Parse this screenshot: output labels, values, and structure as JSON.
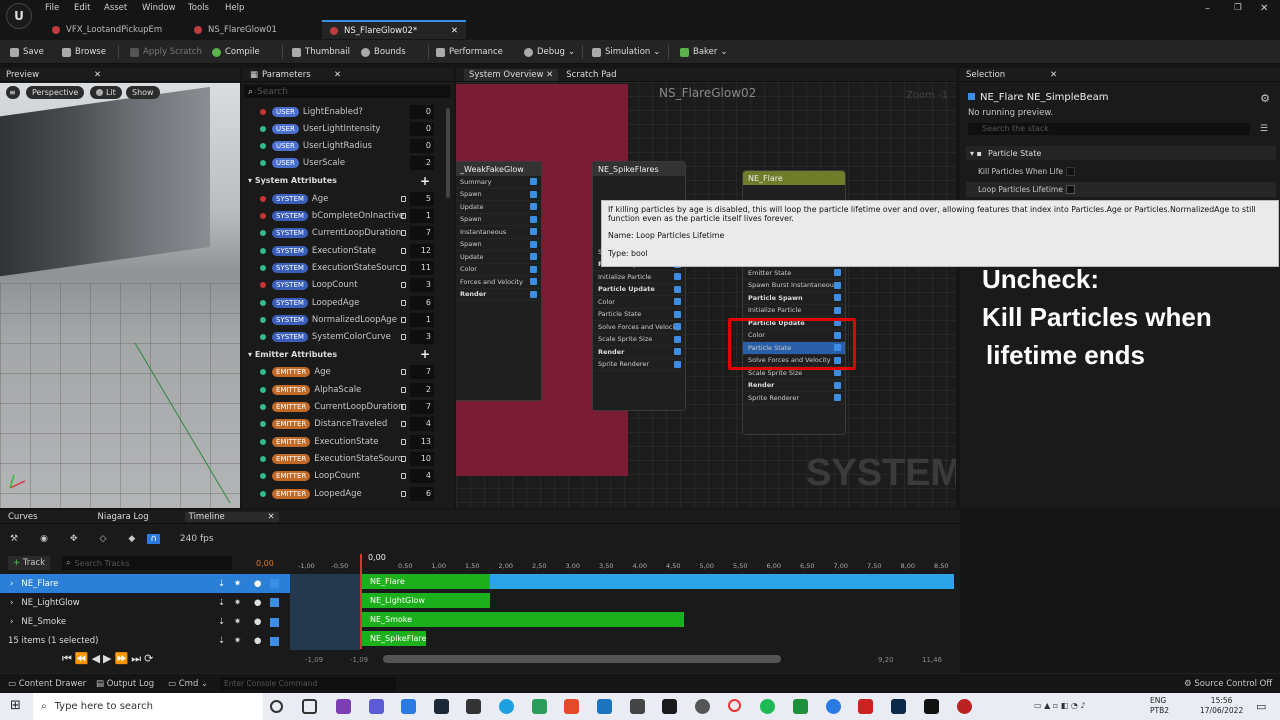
{
  "menu": [
    "File",
    "Edit",
    "Asset",
    "Window",
    "Tools",
    "Help"
  ],
  "tabs": [
    {
      "label": "VFX_LootandPickupEm",
      "color": "#c03c3c"
    },
    {
      "label": "NS_FlareGlow01",
      "color": "#c03c3c"
    },
    {
      "label": "NS_FlareGlow02*",
      "color": "#c03c3c"
    }
  ],
  "toolbar": [
    "Save",
    "Browse",
    "Apply Scratch",
    "Compile",
    "Thumbnail",
    "Bounds",
    "Performance",
    "Debug",
    "Simulation",
    "Baker"
  ],
  "preview": {
    "title": "Preview",
    "perspective": "Perspective",
    "lit": "Lit",
    "show": "Show"
  },
  "params": {
    "title": "Parameters",
    "search_placeholder": "Search",
    "user": [
      {
        "name": "LightEnabled?",
        "value": "0"
      },
      {
        "name": "UserLightIntensity",
        "value": "0"
      },
      {
        "name": "UserLightRadius",
        "value": "0"
      },
      {
        "name": "UserScale",
        "value": "2"
      }
    ],
    "system_header": "System Attributes",
    "system": [
      {
        "name": "Age",
        "value": "5"
      },
      {
        "name": "bCompleteOnInactive",
        "value": "1"
      },
      {
        "name": "CurrentLoopDuration",
        "value": "7"
      },
      {
        "name": "ExecutionState",
        "value": "12"
      },
      {
        "name": "ExecutionStateSourc",
        "value": "11"
      },
      {
        "name": "LoopCount",
        "value": "3"
      },
      {
        "name": "LoopedAge",
        "value": "6"
      },
      {
        "name": "NormalizedLoopAge",
        "value": "1"
      },
      {
        "name": "SystemColorCurve",
        "value": "3"
      }
    ],
    "emitter_header": "Emitter Attributes",
    "emitter": [
      {
        "name": "Age",
        "value": "7"
      },
      {
        "name": "AlphaScale",
        "value": "2"
      },
      {
        "name": "CurrentLoopDuration",
        "value": "7"
      },
      {
        "name": "DistanceTraveled",
        "value": "4"
      },
      {
        "name": "ExecutionState",
        "value": "13"
      },
      {
        "name": "ExecutionStateSourc",
        "value": "10"
      },
      {
        "name": "LoopCount",
        "value": "4"
      },
      {
        "name": "LoopedAge",
        "value": "6"
      }
    ],
    "pill_user": "USER",
    "pill_system": "SYSTEM",
    "pill_emitter": "EMITTER"
  },
  "graph": {
    "tab1": "System Overview",
    "tab2": "Scratch Pad",
    "title": "NS_FlareGlow02",
    "zoom": "Zoom -1",
    "watermark": "SYSTEM",
    "node_a": {
      "title": "_WeakFakeGlow",
      "rows": [
        "Summary",
        "Spawn",
        "Update",
        "Spawn",
        "Instantaneous",
        "Spawn",
        "Update",
        "Color",
        "Forces and Velocity",
        "Render"
      ]
    },
    "node_b": {
      "title": "NE_SpikeFlares",
      "rows": [
        "Spawn Rate",
        "Particle Spawn",
        "Initialize Particle",
        "Particle Update",
        "Color",
        "Particle State",
        "Solve Forces and Velocity",
        "Scale Sprite Size",
        "Render",
        "Sprite Renderer"
      ]
    },
    "node_c": {
      "title": "NE_Flare",
      "rows": [
        "Emitter State",
        "Spawn Burst Instantaneous",
        "Particle Spawn",
        "Initialize Particle",
        "Particle Update",
        "Color",
        "Particle State",
        "Solve Forces and Velocity",
        "Scale Sprite Size",
        "Render",
        "Sprite Renderer"
      ]
    }
  },
  "selection": {
    "title": "Selection",
    "emitter": "NE_Flare",
    "module": "NE_SimpleBeam",
    "status": "No running preview.",
    "search_placeholder": "Search the stack",
    "section": "Particle State",
    "row1": "Kill Particles When Life",
    "row2": "Loop Particles Lifetime"
  },
  "tooltip": {
    "text": "If killing particles by age is disabled, this will loop the particle lifetime over and over, allowing features that index into Particles.Age or Particles.NormalizedAge to still function even as the particle itself lives forever.",
    "name": "Name: Loop Particles Lifetime",
    "type": "Type: bool"
  },
  "annotation": {
    "line1": "Uncheck:",
    "line2": "Kill Particles when",
    "line3": "lifetime ends"
  },
  "bottom": {
    "tabs": [
      "Curves",
      "Niagara Log",
      "Timeline"
    ],
    "fps": "240 fps",
    "track_button": "Track",
    "search_placeholder": "Search Tracks",
    "time": "0,00",
    "cursor_time": "0,00",
    "tracks": [
      "NE_Flare",
      "NE_LightGlow",
      "NE_Smoke"
    ],
    "items_count": "15 items (1 selected)",
    "bars": [
      "NE_Flare",
      "NE_LightGlow",
      "NE_Smoke",
      "NE_SpikeFlare"
    ],
    "ruler": [
      "-1,00",
      "-0,50",
      "0,50",
      "1,00",
      "1,50",
      "2,00",
      "2,50",
      "3,00",
      "3,50",
      "4,00",
      "4,50",
      "5,00",
      "5,50",
      "6,00",
      "6,50",
      "7,00",
      "7,50",
      "8,00",
      "8,50"
    ],
    "range_left": "-1,09",
    "range_left2": "-1,09",
    "range_right": "9,20",
    "range_right2": "11,46"
  },
  "status": {
    "content_drawer": "Content Drawer",
    "output_log": "Output Log",
    "cmd": "Cmd",
    "console_placeholder": "Enter Console Command",
    "source_control": "Source Control Off"
  },
  "taskbar": {
    "search_placeholder": "Type here to search",
    "lang": "ENG",
    "layout": "PTB2",
    "time": "15:56",
    "date": "17/06/2022"
  }
}
